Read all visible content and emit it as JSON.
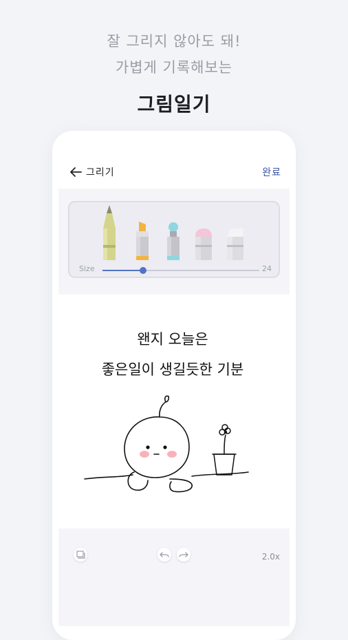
{
  "promo": {
    "line1": "잘 그리지 않아도 돼!",
    "line2": "가볍게 기록해보는",
    "headline": "그림일기"
  },
  "appbar": {
    "title": "그리기",
    "done_label": "완료"
  },
  "tools": [
    {
      "name": "pencil",
      "color": "#d4d48c",
      "selected": true
    },
    {
      "name": "marker",
      "color": "#f2b441"
    },
    {
      "name": "brush",
      "color": "#8fd6e0"
    },
    {
      "name": "highlighter",
      "color": "#f4c6d8"
    },
    {
      "name": "eraser",
      "color": "#e9e9ed"
    }
  ],
  "size": {
    "label": "Size",
    "value": "24",
    "level": 0.26
  },
  "drawing": {
    "line1": "왠지 오늘은",
    "line2": "좋은일이 생길듯한 기분"
  },
  "bottom_bar": {
    "zoom": "2.0x"
  },
  "colors": {
    "accent": "#5373c4",
    "done": "#3d55a8",
    "cheek": "#f7b2b8"
  }
}
